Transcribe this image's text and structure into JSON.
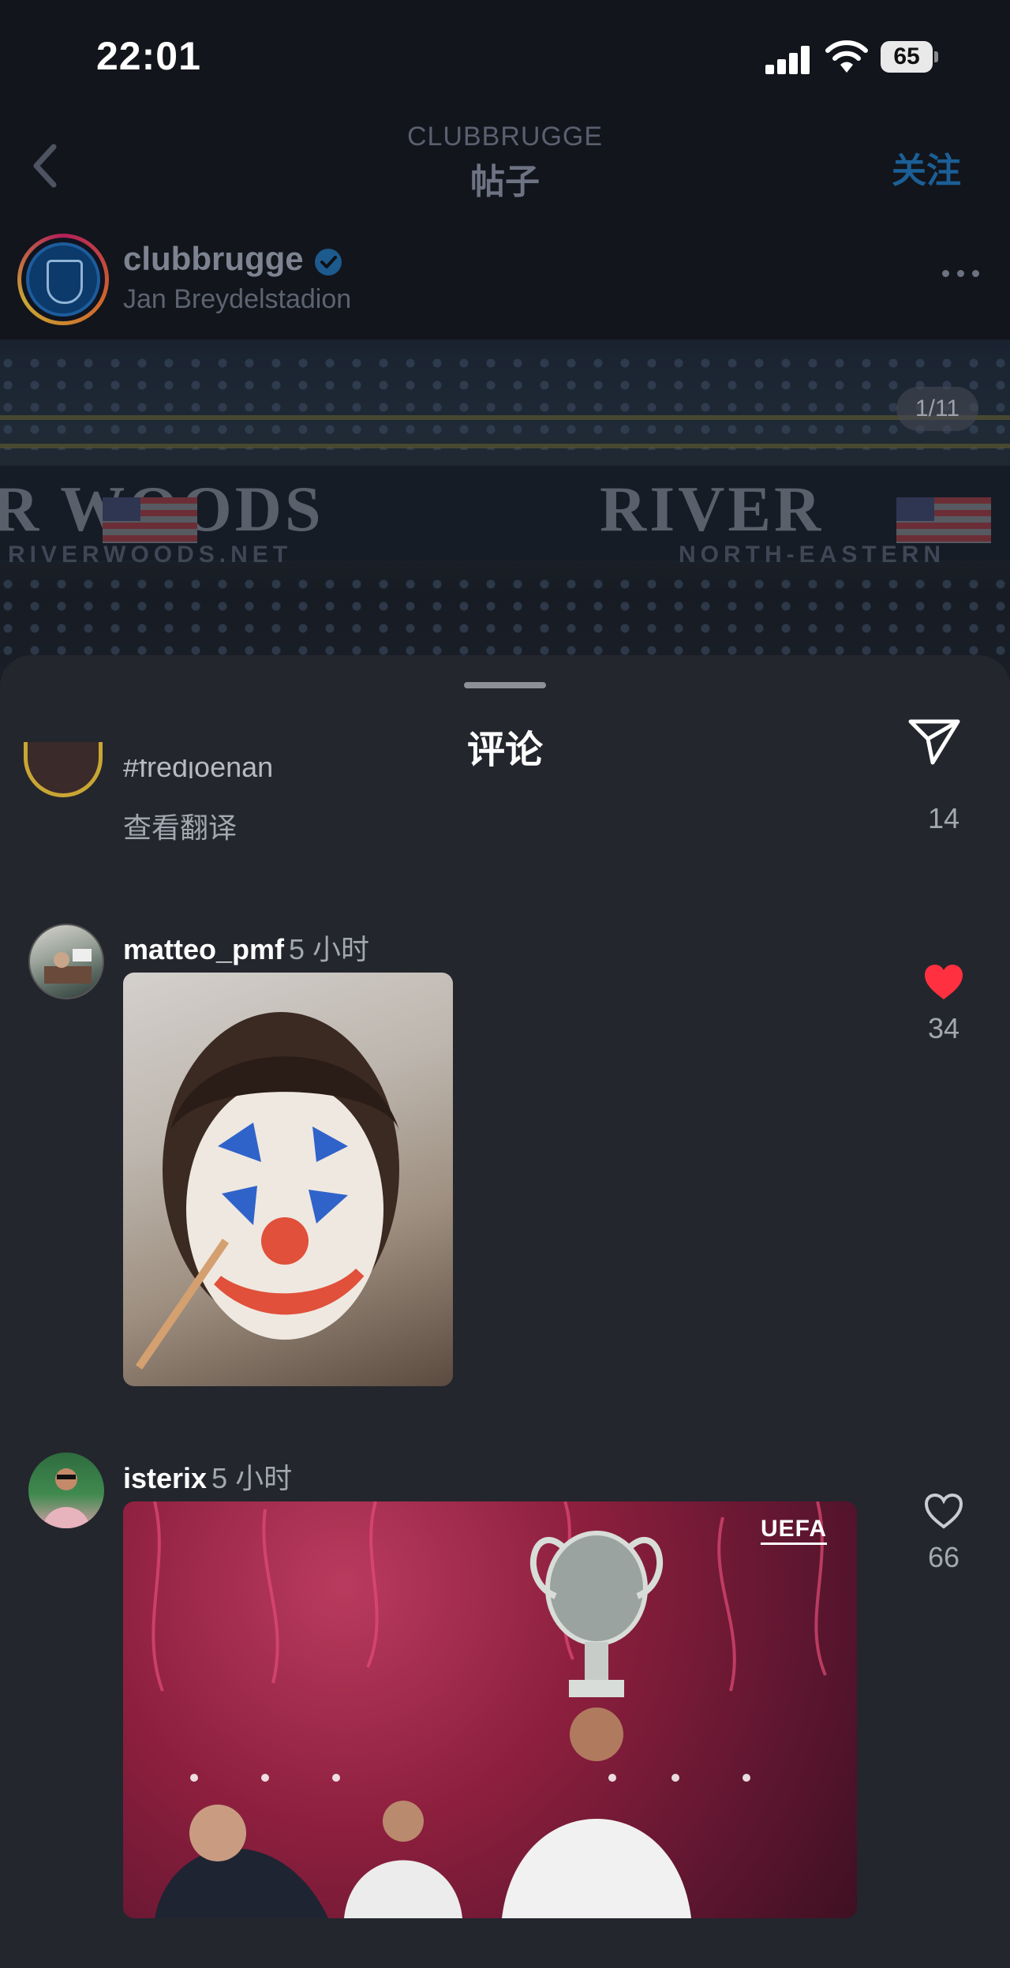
{
  "status_bar": {
    "time": "22:01",
    "battery": "65"
  },
  "nav": {
    "subtitle": "CLUBBRUGGE",
    "title": "帖子",
    "follow_label": "关注"
  },
  "post": {
    "username": "clubbrugge",
    "location": "Jan Breydelstadion",
    "page_indicator": "1/11",
    "image_texts": {
      "banner_left": "R WOODS",
      "banner_right": "RIVER",
      "banner_sub_left": "RIVERWOODS.NET",
      "banner_sub_right": "NORTH-EASTERN"
    }
  },
  "sheet": {
    "title": "评论",
    "partial_comment": {
      "username": "#fredjoenan",
      "translate_label": "查看翻译",
      "likes": "14"
    },
    "comments": [
      {
        "username": "matteo_pmf",
        "time": "5 小时",
        "likes": "34",
        "liked": true,
        "media": "clown-face-gif"
      },
      {
        "username": "isterix",
        "time": "5 小时",
        "likes": "66",
        "liked": false,
        "media": "trophy-celebration-gif",
        "media_overlay": "UEFA"
      }
    ]
  },
  "colors": {
    "accent_follow": "#1b5f96",
    "like_red": "#ff3040",
    "sheet_bg": "#23262d"
  },
  "icons": [
    "back-icon",
    "verified-icon",
    "more-icon",
    "share-icon",
    "heart-icon"
  ]
}
